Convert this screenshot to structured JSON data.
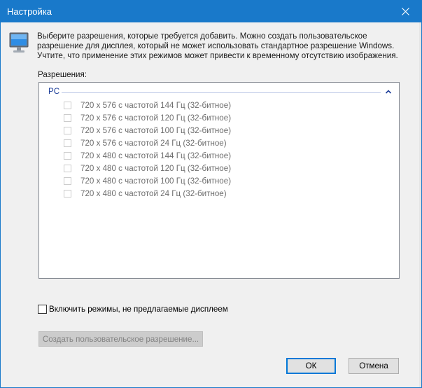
{
  "window": {
    "title": "Настройка",
    "close_icon": "close-icon",
    "title_bar_color": "#1979ca"
  },
  "intro": {
    "icon": "monitor-icon",
    "lines": [
      "Выберите разрешения, которые требуется добавить. Можно создать пользовательское",
      "разрешение для дисплея, который не может использовать стандартное разрешение Windows.",
      "Учтите, что применение этих режимов может привести к временному отсутствию изображения."
    ]
  },
  "permissions": {
    "label": "Разрешения:",
    "group": {
      "title": "PC",
      "toggle_icon": "chevron-up-icon",
      "items": [
        {
          "label": "720 x 576 с частотой 144 Гц (32-битное)",
          "checked": false,
          "enabled": false
        },
        {
          "label": "720 x 576 с частотой 120 Гц (32-битное)",
          "checked": false,
          "enabled": false
        },
        {
          "label": "720 x 576 с частотой 100 Гц (32-битное)",
          "checked": false,
          "enabled": false
        },
        {
          "label": "720 x 576 с частотой 24 Гц (32-битное)",
          "checked": false,
          "enabled": false
        },
        {
          "label": "720 x 480 с частотой 144 Гц (32-битное)",
          "checked": false,
          "enabled": false
        },
        {
          "label": "720 x 480 с частотой 120 Гц (32-битное)",
          "checked": false,
          "enabled": false
        },
        {
          "label": "720 x 480 с частотой 100 Гц (32-битное)",
          "checked": false,
          "enabled": false
        },
        {
          "label": "720 x 480 с частотой 24 Гц (32-битное)",
          "checked": false,
          "enabled": false
        }
      ]
    }
  },
  "include_unsupported": {
    "label": "Включить режимы, не предлагаемые дисплеем",
    "checked": false
  },
  "buttons": {
    "create_custom": "Создать пользовательское разрешение...",
    "ok": "ОК",
    "cancel": "Отмена"
  }
}
